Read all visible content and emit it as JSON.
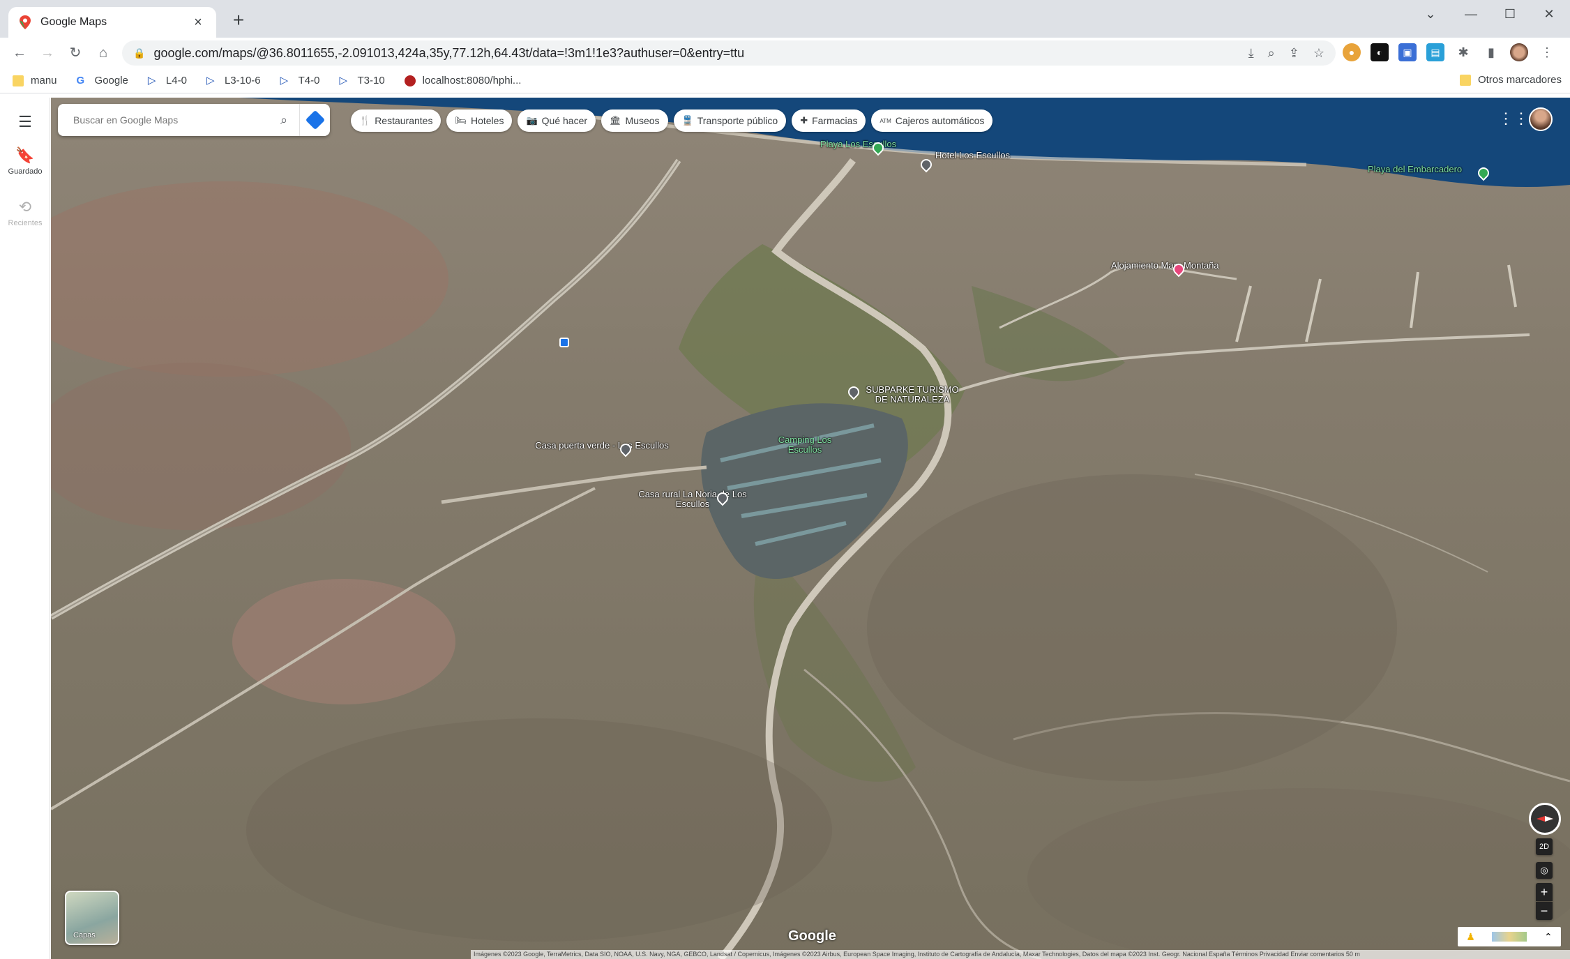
{
  "browser": {
    "tab_title": "Google Maps",
    "new_tab": "+",
    "url": "google.com/maps/@36.8011655,-2.091013,424a,35y,77.12h,64.43t/data=!3m1!1e3?authuser=0&entry=ttu",
    "window_controls": {
      "dropdown": "⌄",
      "minimize": "—",
      "maximize": "☐",
      "close": "✕"
    },
    "bookmarks": [
      {
        "label": "manu",
        "icon": "folder-icon"
      },
      {
        "label": "Google",
        "icon": "google-icon"
      },
      {
        "label": "L4-0",
        "icon": "play-icon"
      },
      {
        "label": "L3-10-6",
        "icon": "play-icon"
      },
      {
        "label": "T4-0",
        "icon": "play-icon"
      },
      {
        "label": "T3-10",
        "icon": "play-icon"
      },
      {
        "label": "localhost:8080/hphi...",
        "icon": "site-icon"
      }
    ],
    "other_bookmarks": "Otros marcadores"
  },
  "maps": {
    "rail": {
      "saved": "Guardado",
      "recent": "Recientes"
    },
    "search_placeholder": "Buscar en Google Maps",
    "chips": [
      {
        "label": "Restaurantes",
        "icon": "🍴"
      },
      {
        "label": "Hoteles",
        "icon": "🛏"
      },
      {
        "label": "Qué hacer",
        "icon": "📷"
      },
      {
        "label": "Museos",
        "icon": "🏛"
      },
      {
        "label": "Transporte público",
        "icon": "🚆"
      },
      {
        "label": "Farmacias",
        "icon": "✚"
      },
      {
        "label": "Cajeros automáticos",
        "icon": "ATM"
      }
    ],
    "places": {
      "playa_escullos": "Playa Los Escullos",
      "hotel_escullos": "Hotel Los Escullos",
      "playa_embarcadero": "Playa del Embarcadero",
      "alojamiento": "Alojamiento Mary Montaña",
      "subparke": "SUBPARKE TURISMO DE NATURALEZA",
      "camping": "Camping Los Escullos",
      "casa_verde": "Casa puerta verde - Los Escullos",
      "casa_noria": "Casa rural La Noria de Los Escullos"
    },
    "layers_label": "Capas",
    "view_2d": "2D",
    "zoom_in": "+",
    "zoom_out": "−",
    "google_logo": "Google",
    "attribution": "Imágenes ©2023 Google, TerraMetrics, Data SIO, NOAA, U.S. Navy, NGA, GEBCO, Landsat / Copernicus, Imágenes ©2023 Airbus, European Space Imaging, Instituto de Cartografía de Andalucía, Maxar Technologies, Datos del mapa ©2023 Inst. Geogr. Nacional    España    Términos    Privacidad    Enviar comentarios    50 m"
  }
}
